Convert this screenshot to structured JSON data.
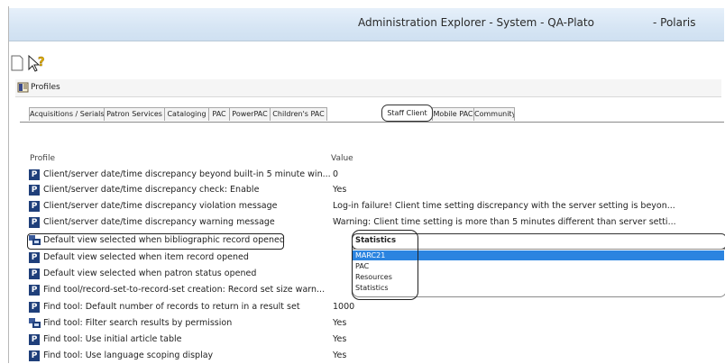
{
  "window": {
    "title": "Administration Explorer - System - QA-Plato",
    "server": "- Polaris"
  },
  "toolbar": {
    "icons": [
      "page-icon",
      "help-cursor-icon"
    ]
  },
  "profiles_bar": {
    "label": "Profiles"
  },
  "tabs": [
    {
      "label": "Acquisitions / Serials"
    },
    {
      "label": "Patron Services"
    },
    {
      "label": "Cataloging"
    },
    {
      "label": "PAC"
    },
    {
      "label": "PowerPAC"
    },
    {
      "label": "Children's PAC"
    },
    {
      "label": "Staff Client",
      "active": true
    },
    {
      "label": "Mobile PAC"
    },
    {
      "label": "Community"
    }
  ],
  "columns": {
    "profile": "Profile",
    "value": "Value"
  },
  "rows": [
    {
      "profile": "Client/server date/time discrepancy beyond built-in 5 minute win...",
      "value": "0",
      "icon": "p-icon"
    },
    {
      "profile": "Client/server date/time discrepancy check: Enable",
      "value": "Yes",
      "icon": "p-icon"
    },
    {
      "profile": "Client/server date/time discrepancy violation message",
      "value": "Log-in failure! Client time setting discrepancy with the server setting is beyon...",
      "icon": "p-icon"
    },
    {
      "profile": "Client/server date/time discrepancy warning message",
      "value": "Warning: Client time setting is more than 5 minutes different than server setti...",
      "icon": "p-icon"
    },
    {
      "profile": "Default view selected when bibliographic record opened",
      "value": "",
      "icon": "chart-icon"
    },
    {
      "profile": "Default view selected when item record opened",
      "value": "",
      "icon": "p-icon"
    },
    {
      "profile": "Default view selected when patron status opened",
      "value": "",
      "icon": "p-icon"
    },
    {
      "profile": "Find tool/record-set-to-record-set creation: Record set size warn...",
      "value": "",
      "icon": "p-icon"
    },
    {
      "profile": "Find tool: Default number of records to return in a result set",
      "value": "1000",
      "icon": "p-icon"
    },
    {
      "profile": "Find tool: Filter search results by permission",
      "value": "Yes",
      "icon": "chart-icon"
    },
    {
      "profile": "Find tool: Use initial article table",
      "value": "Yes",
      "icon": "p-icon"
    },
    {
      "profile": "Find tool: Use language scoping display",
      "value": "Yes",
      "icon": "p-icon"
    }
  ],
  "dropdown": {
    "selected": "Statistics",
    "options": [
      "MARC21",
      "PAC",
      "Resources",
      "Statistics"
    ],
    "highlighted": "MARC21"
  },
  "colors": {
    "icon_blue": "#1f3f7a",
    "highlight": "#2b84e0",
    "titlebar": "#d6e5f4"
  }
}
